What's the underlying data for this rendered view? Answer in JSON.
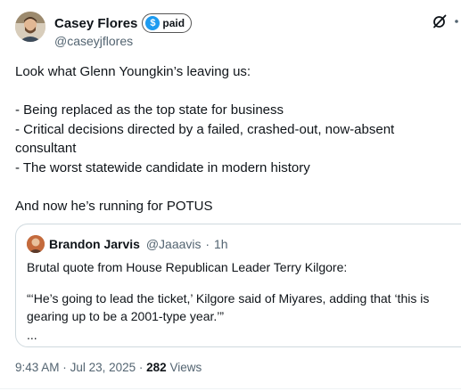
{
  "author": {
    "display_name": "Casey Flores",
    "badge_label": "paid",
    "badge_symbol": "$",
    "handle": "@caseyjflores"
  },
  "header_icons": [
    "grok-icon",
    "more-options-icon"
  ],
  "tweet": {
    "lines": [
      "Look what Glenn Youngkin’s leaving us:",
      "",
      "- Being replaced as the top state for business",
      "- Critical decisions directed by a failed, crashed-out, now-absent consultant",
      "- The worst statewide candidate in modern history",
      "",
      "And now he’s running for POTUS"
    ]
  },
  "quote": {
    "display_name": "Brandon Jarvis",
    "handle": "@Jaaavis",
    "separator": "·",
    "time": "1h",
    "text_line1": "Brutal quote from House Republican Leader Terry Kilgore:",
    "text_line2": "“‘He’s going to lead the ticket,’ Kilgore said of Miyares, adding that ‘this is gearing up to be a 2001-type year.’”",
    "text_line3": "..."
  },
  "footer": {
    "time": "9:43 AM",
    "separator": "·",
    "date": "Jul 23, 2025",
    "views_count": "282",
    "views_label": "Views"
  },
  "colors": {
    "text": "#0f1419",
    "secondary": "#536471",
    "badge_blue": "#1d9bf0",
    "border": "#cfd9de"
  }
}
